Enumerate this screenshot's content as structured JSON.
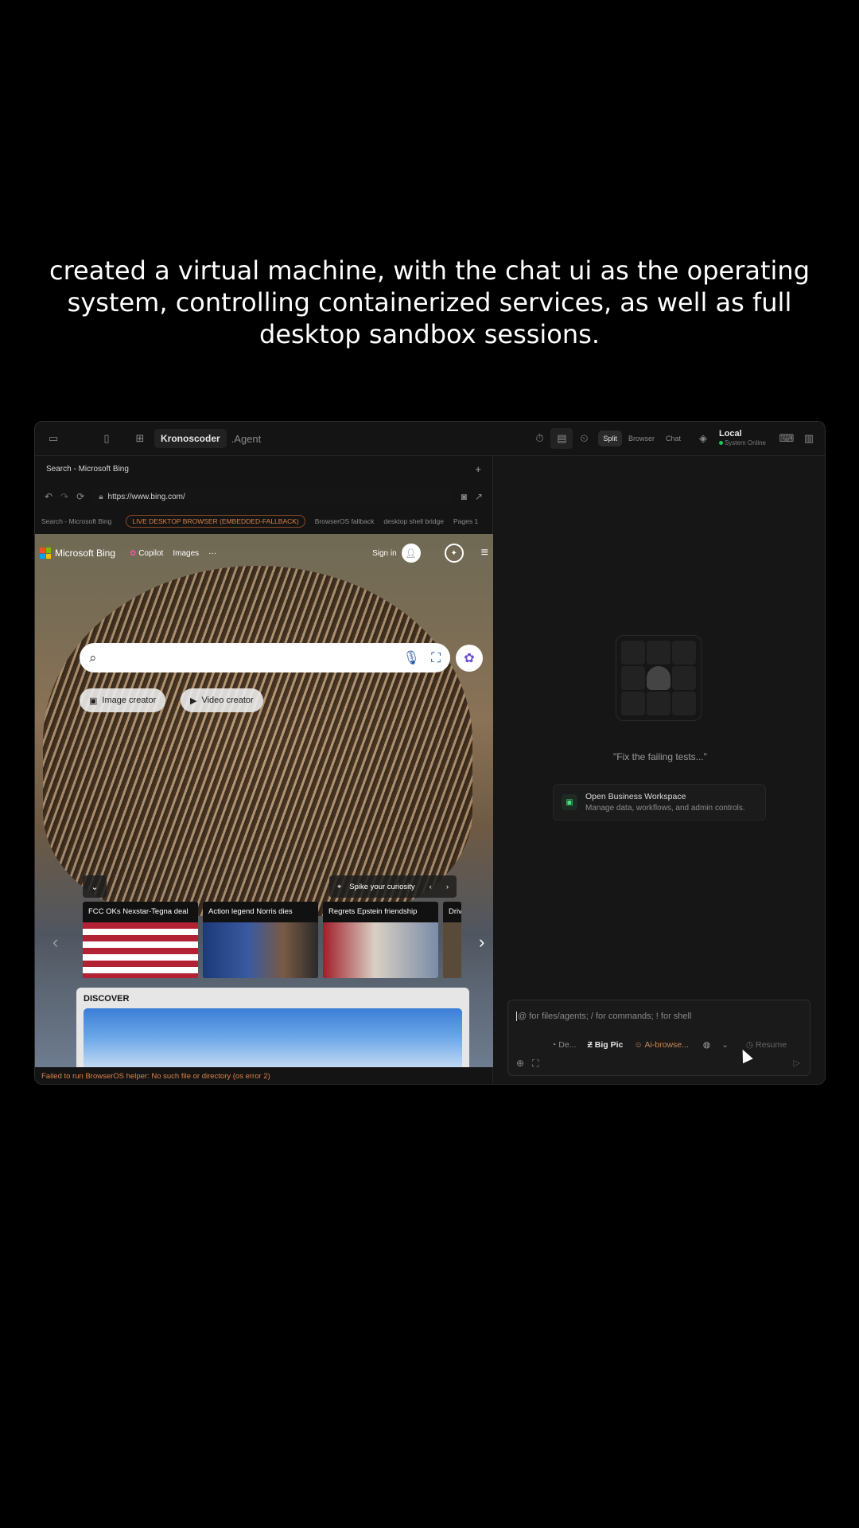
{
  "caption": "created a virtual machine, with the chat ui as the operating system, controlling containerized services, as well as full desktop sandbox sessions.",
  "toolbar": {
    "project": "Kronoscoder",
    "agent": ".Agent",
    "views": [
      "Split",
      "Browser",
      "Chat"
    ],
    "active_view": "Split",
    "env_title": "Local",
    "env_status": "System Online"
  },
  "browser": {
    "tab_title": "Search - Microsoft Bing",
    "url": "https://www.bing.com/",
    "info": {
      "page_title": "Search - Microsoft Bing",
      "live_badge": "LIVE DESKTOP BROWSER (EMBEDDED-FALLBACK)",
      "fallback": "BrowserOS fallback",
      "bridge": "desktop shell bridge",
      "pages": "Pages 1"
    },
    "error": "Failed to run BrowserOS helper: No such file or directory (os error 2)"
  },
  "bing": {
    "brand": "Microsoft Bing",
    "nav": [
      "Copilot",
      "Images",
      "···"
    ],
    "sign_in": "Sign in",
    "chips": [
      "Image creator",
      "Video creator"
    ],
    "spike": "Spike your curiosity",
    "news": [
      "FCC OKs Nexstar-Tegna deal",
      "Action legend Norris dies",
      "Regrets Epstein friendship",
      "Driv"
    ],
    "discover": "DISCOVER"
  },
  "chat": {
    "hint": "\"Fix the failing tests...\"",
    "workspace_title": "Open Business Workspace",
    "workspace_desc": "Manage data, workflows, and admin controls.",
    "placeholder": "@ for files/agents; / for commands; ! for shell",
    "model_short": "De...",
    "mode": "Big Pic",
    "agent": "Ai-browse...",
    "resume": "Resume"
  }
}
